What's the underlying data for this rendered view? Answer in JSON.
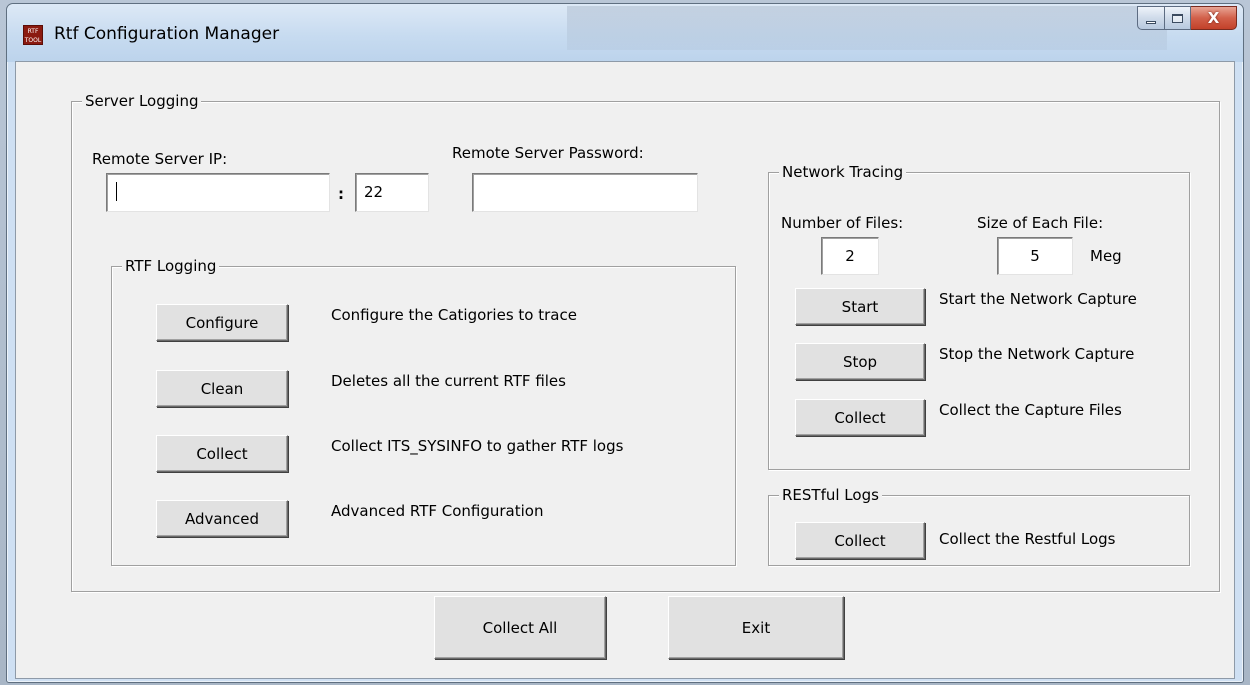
{
  "window": {
    "title": "Rtf Configuration Manager",
    "app_icon_text": "RTF TOOL"
  },
  "server_logging": {
    "legend": "Server Logging",
    "remote_ip_label": "Remote Server IP:",
    "remote_ip_value": "",
    "port_separator": ":",
    "port_value": "22",
    "password_label": "Remote Server Password:",
    "password_value": ""
  },
  "rtf_logging": {
    "legend": "RTF Logging",
    "rows": [
      {
        "button": "Configure",
        "description": "Configure the Catigories to trace"
      },
      {
        "button": "Clean",
        "description": "Deletes all the current RTF files"
      },
      {
        "button": "Collect",
        "description": "Collect ITS_SYSINFO to gather RTF logs"
      },
      {
        "button": "Advanced",
        "description": "Advanced RTF Configuration"
      }
    ]
  },
  "network_tracing": {
    "legend": "Network Tracing",
    "num_files_label": "Number of Files:",
    "num_files_value": "2",
    "file_size_label": "Size of Each File:",
    "file_size_value": "5",
    "file_size_unit": "Meg",
    "rows": [
      {
        "button": "Start",
        "description": "Start the Network Capture"
      },
      {
        "button": "Stop",
        "description": "Stop the Network Capture"
      },
      {
        "button": "Collect",
        "description": "Collect the Capture Files"
      }
    ]
  },
  "restful_logs": {
    "legend": "RESTful Logs",
    "button": "Collect",
    "description": "Collect the Restful Logs"
  },
  "footer": {
    "collect_all": "Collect All",
    "exit": "Exit"
  },
  "colors": {
    "client_bg": "#f0f0f0",
    "button_face": "#e1e1e1",
    "close_button": "#c2412a"
  }
}
